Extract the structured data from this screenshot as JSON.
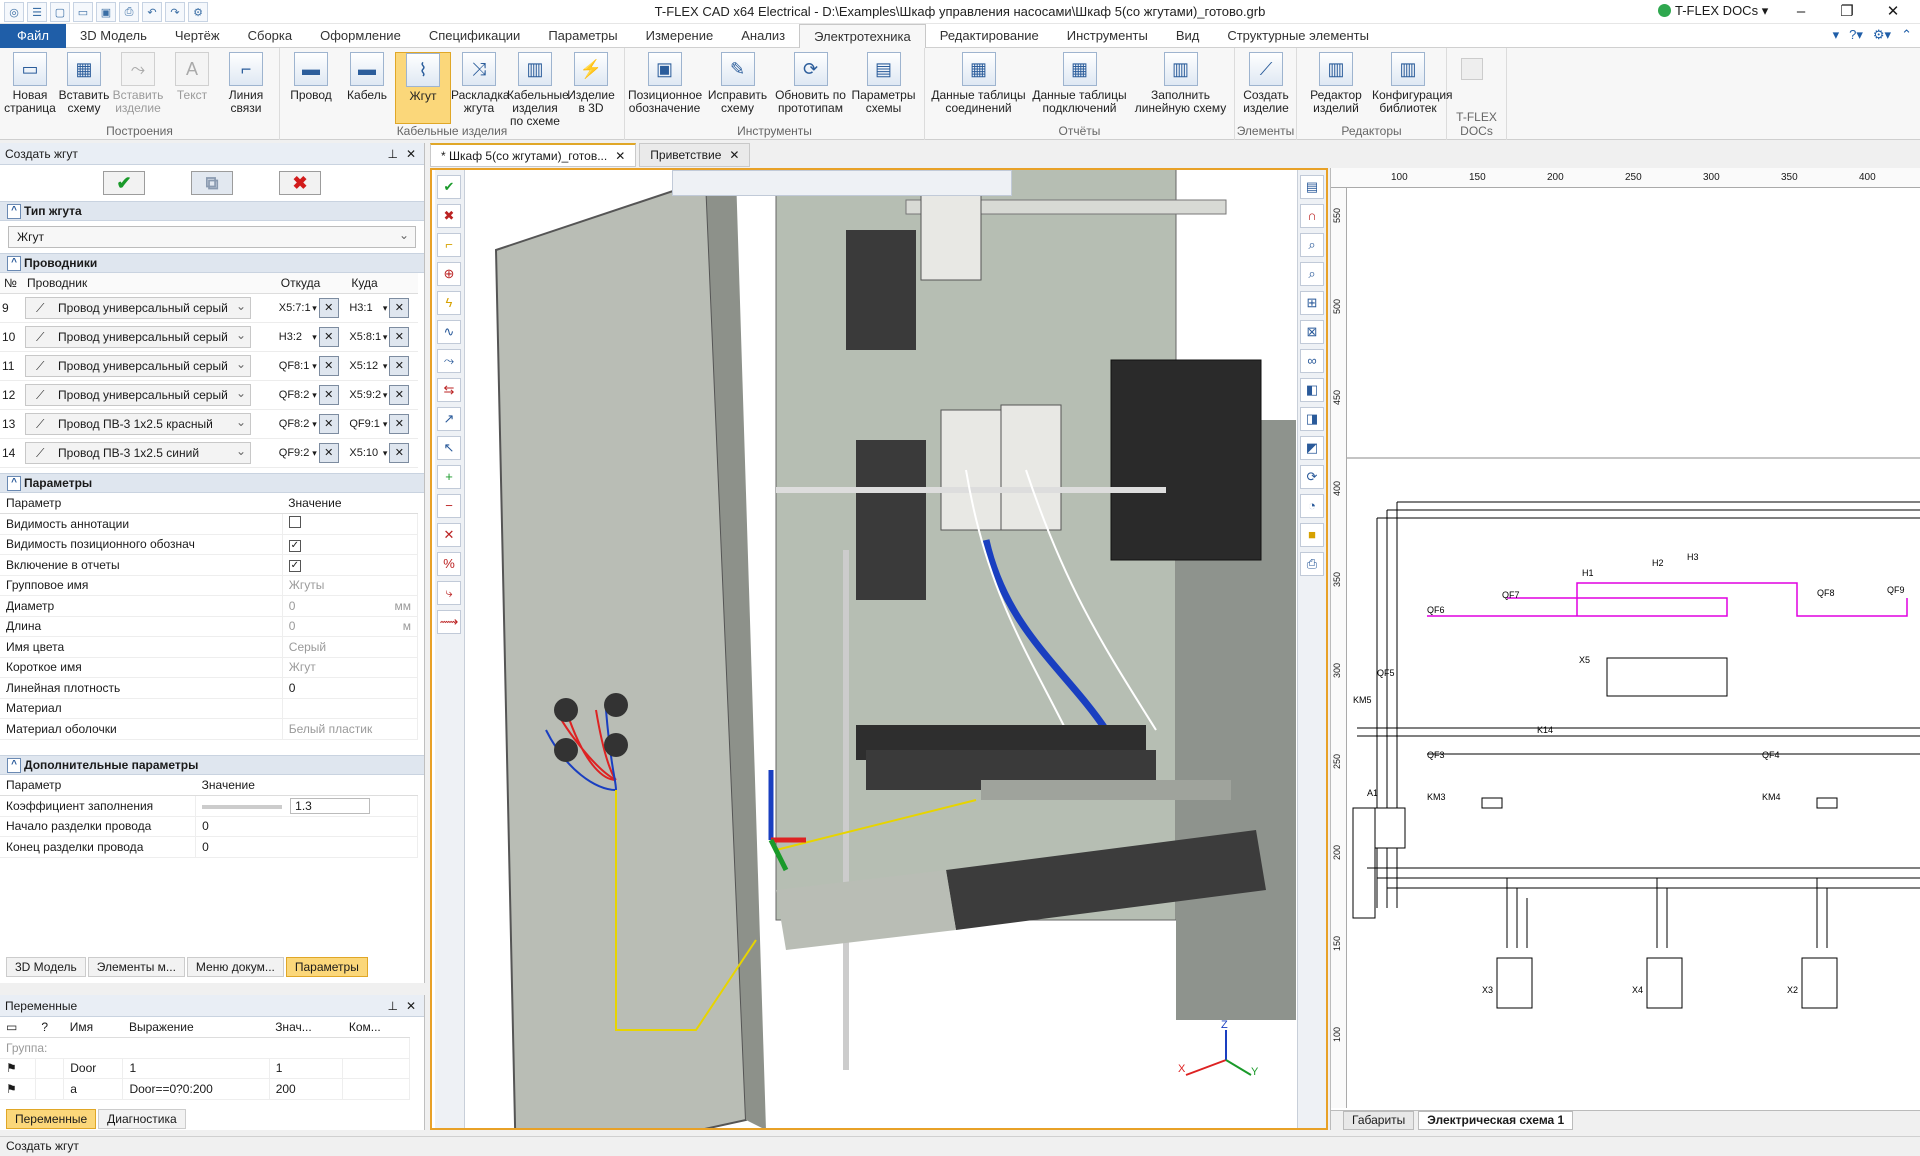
{
  "title": "T-FLEX CAD x64 Electrical - D:\\Examples\\Шкаф управления насосами\\Шкаф 5(со жгутами)_готово.grb",
  "docs_brand": "T-FLEX DOCs",
  "tabs": [
    "Файл",
    "3D Модель",
    "Чертёж",
    "Сборка",
    "Оформление",
    "Спецификации",
    "Параметры",
    "Измерение",
    "Анализ",
    "Электротехника",
    "Редактирование",
    "Инструменты",
    "Вид",
    "Структурные элементы"
  ],
  "active_tab": "Электротехника",
  "ribbon": {
    "groups": [
      {
        "label": "Построения",
        "buttons": [
          "Новая страница",
          "Вставить схему",
          "Вставить изделие",
          "Текст",
          "Линия связи"
        ]
      },
      {
        "label": "Кабельные изделия",
        "buttons": [
          "Провод",
          "Кабель",
          "Жгут",
          "Раскладка жгута",
          "Кабельные изделия по схеме",
          "Изделие в 3D"
        ]
      },
      {
        "label": "Инструменты",
        "buttons": [
          "Позиционное обозначение",
          "Исправить схему",
          "Обновить по прототипам",
          "Параметры схемы"
        ]
      },
      {
        "label": "Отчёты",
        "buttons": [
          "Данные таблицы соединений",
          "Данные таблицы подключений",
          "Заполнить линейную схему"
        ]
      },
      {
        "label": "Элементы",
        "buttons": [
          "Создать изделие"
        ]
      },
      {
        "label": "Редакторы",
        "buttons": [
          "Редактор изделий",
          "Конфигурация библиотек"
        ]
      },
      {
        "label": "T-FLEX DOCs",
        "buttons": []
      }
    ]
  },
  "panel": {
    "title": "Создать жгут",
    "section_type": "Тип жгута",
    "harness_type": "Жгут",
    "section_wires": "Проводники",
    "wires_columns": [
      "№",
      "Проводник",
      "Откуда",
      "Куда"
    ],
    "wires": [
      {
        "n": "9",
        "name": "Провод универсальный серый",
        "from": "X5:7:1",
        "to": "H3:1"
      },
      {
        "n": "10",
        "name": "Провод универсальный серый",
        "from": "H3:2",
        "to": "X5:8:1"
      },
      {
        "n": "11",
        "name": "Провод универсальный серый",
        "from": "QF8:1",
        "to": "X5:12"
      },
      {
        "n": "12",
        "name": "Провод универсальный серый",
        "from": "QF8:2",
        "to": "X5:9:2"
      },
      {
        "n": "13",
        "name": "Провод ПВ-3 1х2.5 красный",
        "from": "QF8:2",
        "to": "QF9:1"
      },
      {
        "n": "14",
        "name": "Провод ПВ-3 1х2.5 синий",
        "from": "QF9:2",
        "to": "X5:10"
      }
    ],
    "section_params": "Параметры",
    "params_columns": [
      "Параметр",
      "Значение"
    ],
    "params": [
      {
        "k": "Видимость аннотации",
        "v": "",
        "cb": "off"
      },
      {
        "k": "Видимость позиционного обознач",
        "v": "",
        "cb": "on"
      },
      {
        "k": "Включение в отчеты",
        "v": "",
        "cb": "on"
      },
      {
        "k": "Групповое имя",
        "v": "Жгуты",
        "gray": true
      },
      {
        "k": "Диаметр",
        "v": "0",
        "unit": "мм",
        "gray": true
      },
      {
        "k": "Длина",
        "v": "0",
        "unit": "м",
        "gray": true
      },
      {
        "k": "Имя цвета",
        "v": "Серый",
        "gray": true
      },
      {
        "k": "Короткое имя",
        "v": "Жгут",
        "gray": true
      },
      {
        "k": "Линейная плотность",
        "v": "0"
      },
      {
        "k": "Материал",
        "v": ""
      },
      {
        "k": "Материал оболочки",
        "v": "Белый пластик",
        "gray": true
      }
    ],
    "section_extra": "Дополнительные параметры",
    "extra": [
      {
        "k": "Коэффициент заполнения",
        "v": "1.3"
      },
      {
        "k": "Начало разделки провода",
        "v": "0"
      },
      {
        "k": "Конец разделки провода",
        "v": "0"
      }
    ],
    "bottom_tabs": [
      "3D Модель",
      "Элементы м...",
      "Меню докум...",
      "Параметры"
    ]
  },
  "vars": {
    "title": "Переменные",
    "columns": [
      "?",
      "Имя",
      "Выражение",
      "Знач...",
      "Ком..."
    ],
    "group_label": "Группа:",
    "rows": [
      {
        "name": "Door",
        "expr": "1",
        "val": "1"
      },
      {
        "name": "a",
        "expr": "Door==0?0:200",
        "val": "200"
      }
    ],
    "tabs": [
      "Переменные",
      "Диагностика"
    ]
  },
  "doc_tabs": [
    "* Шкаф 5(со жгутами)_готов...",
    "Приветствие"
  ],
  "sheet_tabs": [
    "Габариты",
    "Электрическая схема 1"
  ],
  "axes": {
    "x": "X",
    "y": "Y",
    "z": "Z"
  },
  "ruler_top": [
    "100",
    "150",
    "200",
    "250",
    "300",
    "350",
    "400"
  ],
  "ruler_left": [
    "550",
    "500",
    "450",
    "400",
    "350",
    "300",
    "250",
    "200",
    "150",
    "100"
  ],
  "schematic_labels": [
    "QF6",
    "QF7",
    "H1",
    "H2",
    "H3",
    "QF8",
    "QF9",
    "X5",
    "QF5",
    "KM5",
    "K14",
    "QF3",
    "KM3",
    "QF4",
    "KM4",
    "A1",
    "X3",
    "X4",
    "X2"
  ],
  "status": "Создать жгут"
}
